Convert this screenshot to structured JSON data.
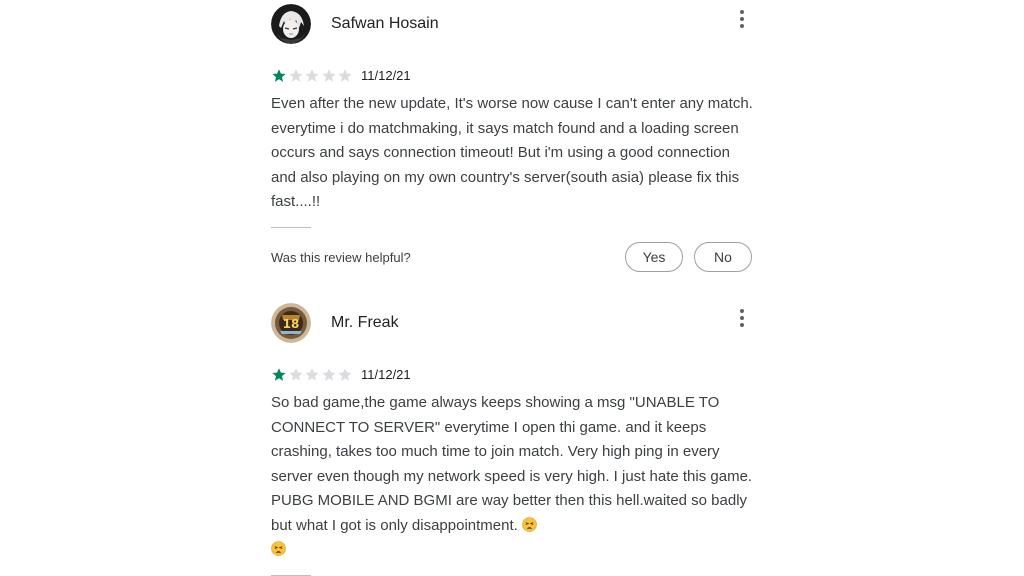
{
  "reviews": [
    {
      "author": "Safwan Hosain",
      "rating": 1,
      "max_rating": 5,
      "date": "11/12/21",
      "text": "Even after the new update, It's worse now cause I can't enter any match. everytime i do matchmaking, it says match found and a loading screen occurs and says connection timeout! But i'm using a good connection and also playing on my own country's server(south asia) please fix this fast....!!",
      "helpful_prompt": "Was this review helpful?",
      "yes_label": "Yes",
      "no_label": "No"
    },
    {
      "author": "Mr. Freak",
      "rating": 1,
      "max_rating": 5,
      "date": "11/12/21",
      "text": "So bad game,the game always keeps showing a msg \"UNABLE TO CONNECT TO SERVER\" everytime I open thi game. and it keeps crashing, takes too much time to join match. Very high ping in every server even though my network speed is very high. I just hate this game. PUBG MOBILE AND BGMI are way better then this hell.waited so badly but what I got is only disappointment.",
      "emoji_count": 2,
      "emoji_name": "tired-face-emoji"
    }
  ],
  "colors": {
    "star_filled": "#01875f",
    "star_empty": "#dadce0"
  }
}
